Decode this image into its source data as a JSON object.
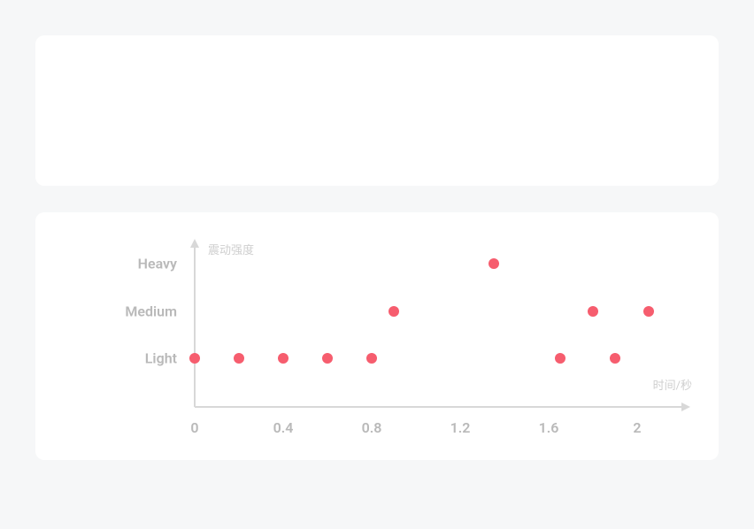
{
  "chart_data": {
    "type": "scatter",
    "title": "",
    "xlabel": "时间/秒",
    "ylabel": "震动强度",
    "y_categories": [
      "Light",
      "Medium",
      "Heavy"
    ],
    "x_ticks": [
      0,
      0.4,
      0.8,
      1.2,
      1.6,
      2.0
    ],
    "xlim": [
      0,
      2.2
    ],
    "points": [
      {
        "x": 0.0,
        "y": "Light"
      },
      {
        "x": 0.2,
        "y": "Light"
      },
      {
        "x": 0.4,
        "y": "Light"
      },
      {
        "x": 0.6,
        "y": "Light"
      },
      {
        "x": 0.8,
        "y": "Light"
      },
      {
        "x": 0.9,
        "y": "Medium"
      },
      {
        "x": 1.35,
        "y": "Heavy"
      },
      {
        "x": 1.65,
        "y": "Light"
      },
      {
        "x": 1.8,
        "y": "Medium"
      },
      {
        "x": 1.9,
        "y": "Light"
      },
      {
        "x": 2.05,
        "y": "Medium"
      }
    ],
    "color": "#f65d6e"
  }
}
